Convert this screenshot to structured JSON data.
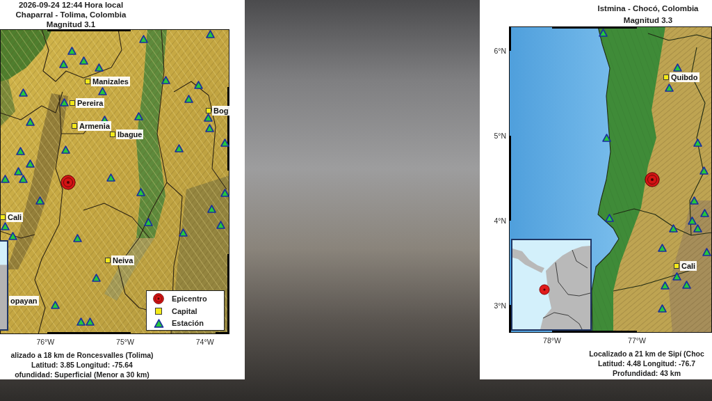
{
  "maps": [
    {
      "title_lines": [
        "2026-09-24 12:44 Hora local",
        "Chaparral - Tolima, Colombia",
        "Magnitud 3.1"
      ],
      "cities": [
        {
          "name": "Manizales",
          "capital_marker": true
        },
        {
          "name": "Pereira",
          "capital_marker": true
        },
        {
          "name": "Bog",
          "capital_marker": true
        },
        {
          "name": "Armenia",
          "capital_marker": true
        },
        {
          "name": "Ibague",
          "capital_marker": true
        },
        {
          "name": "Cali",
          "capital_marker": true
        },
        {
          "name": "Neiva",
          "capital_marker": true
        },
        {
          "name": "opayan",
          "capital_marker": false
        }
      ],
      "legend": [
        {
          "kind": "epicenter",
          "label": "Epicentro"
        },
        {
          "kind": "capital",
          "label": "Capital"
        },
        {
          "kind": "station",
          "label": "Estación"
        }
      ],
      "x_ticks": [
        "76°W",
        "75°W",
        "74°W"
      ],
      "caption_lines": [
        "alizado a 18 km de Roncesvalles (Tolima)",
        "Latitud: 3.85 Longitud: -75.64",
        "ofundidad: Superficial (Menor a 30 km)"
      ]
    },
    {
      "title_lines": [
        "Istmina - Chocó, Colombia",
        "Magnitud 3.3"
      ],
      "cities": [
        {
          "name": "Quibdo",
          "capital_marker": true
        },
        {
          "name": "Cali",
          "capital_marker": true
        }
      ],
      "y_ticks": [
        "6°N",
        "5°N",
        "4°N",
        "3°N"
      ],
      "x_ticks": [
        "78°W",
        "77°W"
      ],
      "caption_lines": [
        "Localizado a 21 km de Sipí (Choc",
        "Latitud: 4.48 Longitud: -76.7",
        "Profundidad: 43 km"
      ]
    }
  ]
}
